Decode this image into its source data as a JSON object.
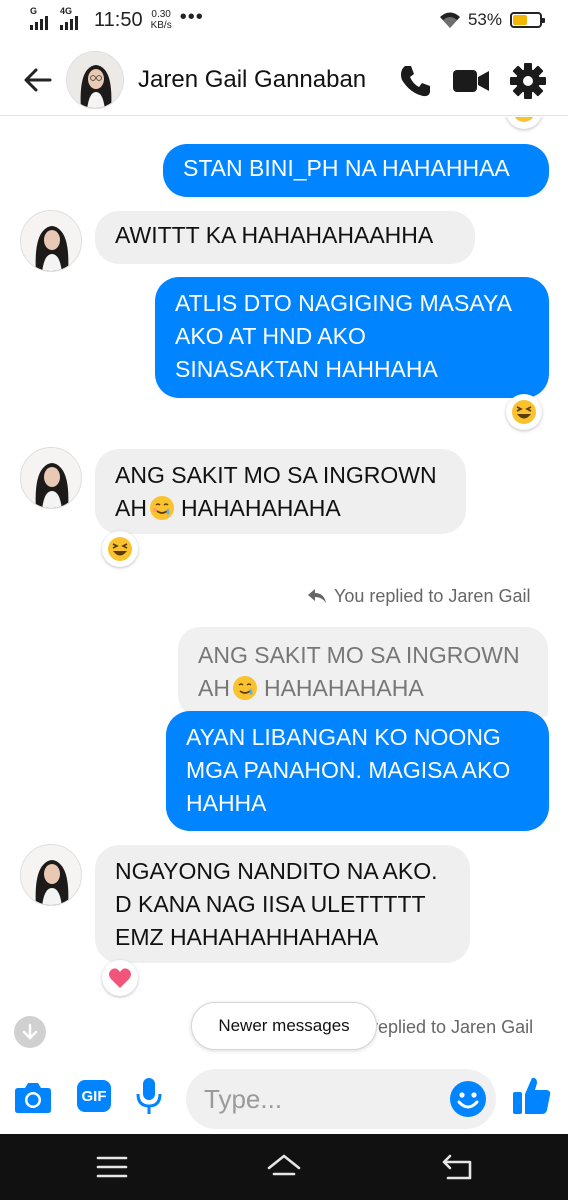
{
  "status_bar": {
    "network_top": "G",
    "network_second": "4G",
    "time": "11:50",
    "speed_value": "0.30",
    "speed_unit": "KB/s",
    "more": "•••",
    "battery_percent": "53%",
    "battery_level": 0.53,
    "icons": [
      "signal-icon",
      "wifi-icon",
      "battery-icon"
    ]
  },
  "header": {
    "contact_name": "Jaren Gail Gannaban",
    "icons": [
      "back-arrow-icon",
      "phone-icon",
      "video-camera-icon",
      "gear-icon"
    ]
  },
  "messages": [
    {
      "side": "out",
      "text": "STAN BINI_PH NA HAHAHHAA"
    },
    {
      "side": "in",
      "text": "AWITTT KA HAHAHAHAAHHA"
    },
    {
      "side": "out",
      "lines": [
        "ATLIS DTO NAGIGING MASAYA",
        "AKO AT HND AKO",
        "SINASAKTAN HAHHAHA"
      ],
      "reaction": "grinning-squint-emoji"
    },
    {
      "side": "in",
      "lines": [
        "ANG SAKIT MO SA INGROWN",
        "AH",
        "HAHAHAHAHA"
      ],
      "inline_emoji": "smiling-face-with-tear-emoji",
      "reaction": "grinning-squint-emoji"
    },
    {
      "side": "note",
      "text": "You replied to Jaren Gail"
    },
    {
      "side": "quote",
      "lines": [
        "ANG SAKIT MO SA INGROWN",
        "AH",
        "HAHAHAHAHA"
      ],
      "inline_emoji": "smiling-face-with-tear-emoji"
    },
    {
      "side": "out",
      "lines": [
        "AYAN LIBANGAN KO NOONG",
        "MGA PANAHON. MAGISA AKO",
        "HAHHA"
      ]
    },
    {
      "side": "in",
      "lines": [
        "NGAYONG NANDITO NA AKO.",
        "D KANA NAG IISA ULETTTTT",
        "EMZ HAHAHAHHAHAHA"
      ],
      "reaction": "heart-emoji"
    },
    {
      "side": "note",
      "text": "replied to Jaren Gail"
    }
  ],
  "newer_messages_label": "Newer messages",
  "composer": {
    "placeholder": "Type...",
    "gif_label": "GIF",
    "icons": [
      "camera-icon",
      "gif-icon",
      "microphone-icon",
      "emoji-icon",
      "thumbs-up-icon"
    ]
  },
  "colors": {
    "accent": "#0084ff",
    "incoming_bubble": "#efefef",
    "nav_bar": "#111111",
    "battery_fill": "#f2b705"
  },
  "nav_bar": {
    "icons": [
      "menu-icon",
      "home-icon",
      "back-icon"
    ]
  }
}
